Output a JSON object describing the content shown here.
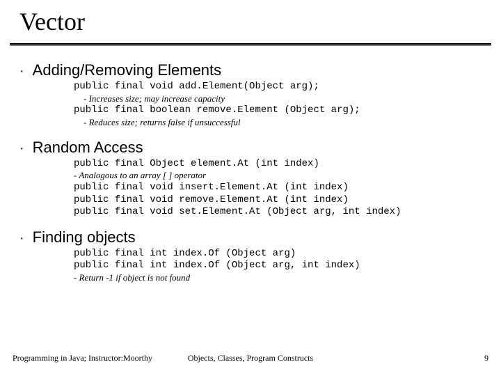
{
  "title": "Vector",
  "sections": [
    {
      "heading": "Adding/Removing Elements",
      "items": [
        {
          "type": "code",
          "text": "public final void add.Element(Object arg);"
        },
        {
          "type": "note",
          "text": "- Increases size; may increase capacity",
          "indent": "in"
        },
        {
          "type": "code",
          "text": "public final boolean remove.Element (Object arg);"
        },
        {
          "type": "note",
          "text": "- Reduces size; returns false if unsuccessful",
          "indent": "in"
        }
      ]
    },
    {
      "heading": "Random Access",
      "items": [
        {
          "type": "code",
          "text": "public final Object element.At (int index)"
        },
        {
          "type": "note",
          "text": "- Analogous to an array [ ] operator",
          "indent": "left"
        },
        {
          "type": "code",
          "text": "public final void insert.Element.At (int index)"
        },
        {
          "type": "code",
          "text": "public final void remove.Element.At (int index)"
        },
        {
          "type": "code",
          "text": "public final void set.Element.At (Object arg, int index)"
        }
      ]
    },
    {
      "heading": "Finding objects",
      "items": [
        {
          "type": "code",
          "text": "public final int index.Of (Object arg)"
        },
        {
          "type": "code",
          "text": "public final int index.Of (Object arg, int index)"
        },
        {
          "type": "note",
          "text": "- Return -1 if object is not found",
          "indent": "left"
        }
      ]
    }
  ],
  "footer": {
    "left": "Programming in Java; Instructor:Moorthy",
    "center": "Objects, Classes, Program Constructs",
    "right": "9"
  },
  "bullet_char": "·"
}
